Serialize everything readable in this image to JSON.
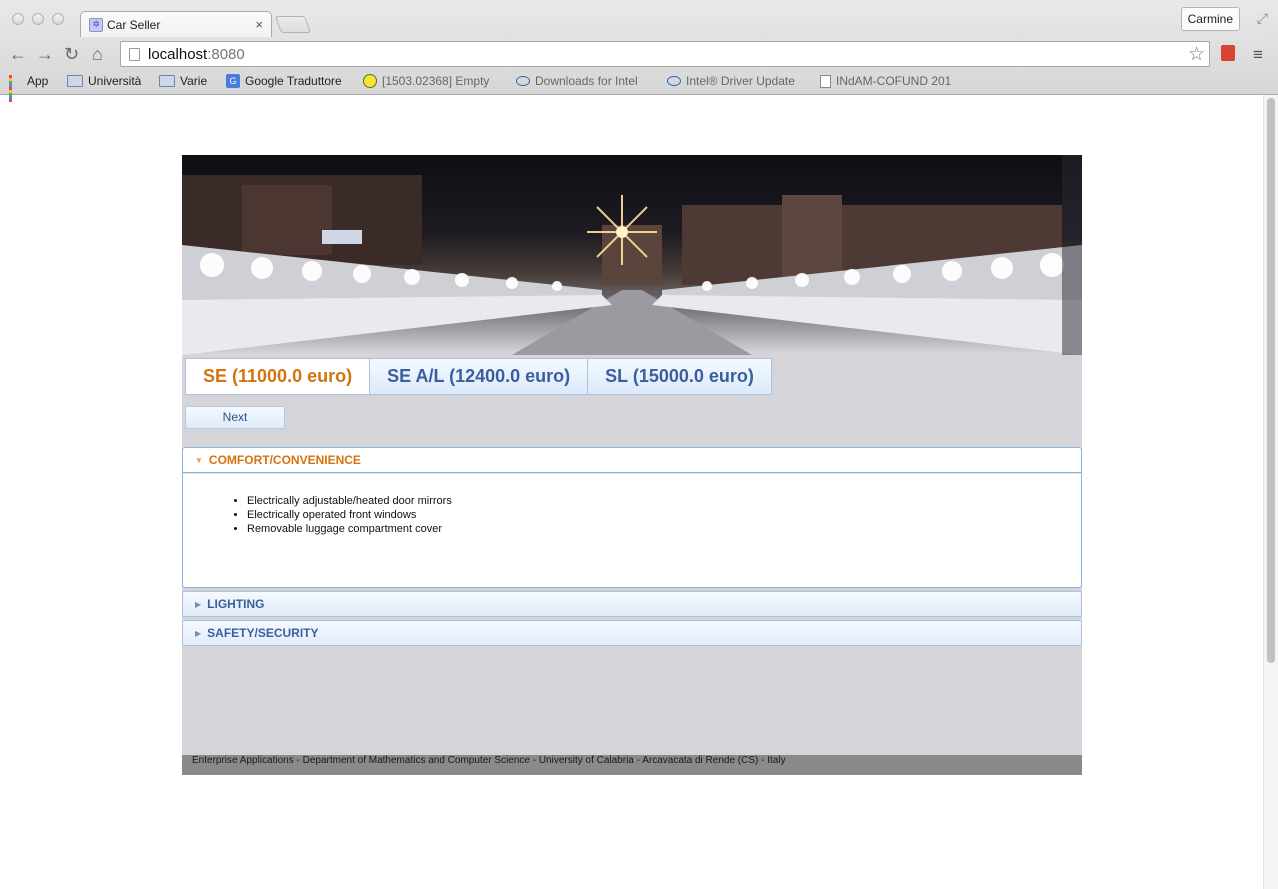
{
  "browser": {
    "tab_title": "Car Seller",
    "tab_close": "×",
    "user_button": "Carmine",
    "url_host": "localhost",
    "url_port": ":8080",
    "bookmarks": [
      {
        "label": "App",
        "icon": "apps-icon"
      },
      {
        "label": "Università",
        "icon": "folder-icon"
      },
      {
        "label": "Varie",
        "icon": "folder-icon"
      },
      {
        "label": "Google Traduttore",
        "icon": "google-translate-icon"
      },
      {
        "label": "[1503.02368] Empty",
        "icon": "smiley-icon"
      },
      {
        "label": "Downloads for Intel",
        "icon": "intel-icon"
      },
      {
        "label": "Intel® Driver Update",
        "icon": "intel-icon"
      },
      {
        "label": "INdAM-COFUND 201",
        "icon": "document-icon"
      }
    ]
  },
  "tabs": [
    {
      "label": "SE (11000.0 euro)",
      "active": true
    },
    {
      "label": "SE A/L (12400.0 euro)",
      "active": false
    },
    {
      "label": "SL (15000.0 euro)",
      "active": false
    }
  ],
  "next_button": "Next",
  "accordion": [
    {
      "title": "COMFORT/CONVENIENCE",
      "open": true,
      "items": [
        "Electrically adjustable/heated door mirrors",
        "Electrically operated front windows",
        "Removable luggage compartment cover"
      ]
    },
    {
      "title": "LIGHTING",
      "open": false
    },
    {
      "title": "SAFETY/SECURITY",
      "open": false
    }
  ],
  "footer": "Enterprise Applications - Department of Mathematics and Computer Science - University of Calabria - Arcavacata di Rende (CS) - Italy",
  "colors": {
    "active_tab_text": "#d2730d",
    "inactive_tab_text": "#3a5f9c",
    "content_background": "#d5d4d9",
    "footer_background": "#8a8a8a"
  }
}
